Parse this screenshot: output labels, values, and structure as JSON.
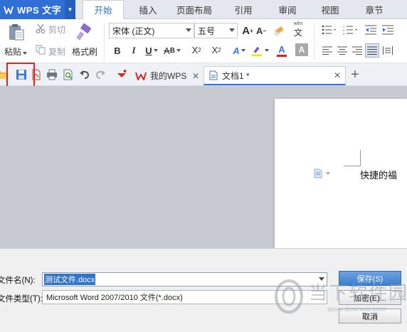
{
  "app": {
    "name": "WPS 文字"
  },
  "menu_tabs": [
    {
      "label": "开始",
      "active": true
    },
    {
      "label": "插入"
    },
    {
      "label": "页面布局"
    },
    {
      "label": "引用"
    },
    {
      "label": "审阅"
    },
    {
      "label": "视图"
    },
    {
      "label": "章节"
    }
  ],
  "ribbon": {
    "paste_label": "粘贴",
    "cut_label": "剪切",
    "copy_label": "复制",
    "format_painter_label": "格式刷",
    "font_name": "宋体 (正文)",
    "font_size": "五号",
    "phonetic_label": "wén",
    "phonetic_char": "文",
    "font_buttons": {
      "bold": "B",
      "italic": "I",
      "underline": "U",
      "grow": "A",
      "shrink": "A",
      "superscript": "X",
      "subscript": "X",
      "sup_mark": "2",
      "sub_mark": "2",
      "effect": "A",
      "font_color": "A",
      "char_shading": "A",
      "highlight_color": "#f5e400",
      "font_color_value": "#e02020"
    }
  },
  "quick_access": {
    "icons": [
      "open-icon",
      "save-icon",
      "export-pdf-icon",
      "print-icon",
      "print-preview-icon",
      "undo-icon",
      "redo-icon",
      "customize-icon"
    ]
  },
  "doc_tabs": [
    {
      "label": "我的WPS",
      "active": false
    },
    {
      "label": "文档1 *",
      "active": true
    }
  ],
  "document": {
    "visible_text": "快捷的福"
  },
  "save_dialog": {
    "filename_label": "文件名(N):",
    "filename_value": "测试文件.docx",
    "filetype_label": "文件类型(T):",
    "filetype_value": "Microsoft Word 2007/2010 文件(*.docx)",
    "save_button": "保存(S)",
    "encrypt_button": "加密(E)...",
    "cancel_button": "取消"
  },
  "watermark": {
    "title": "当下软件园",
    "url": "www.downxia.com"
  },
  "colors": {
    "brand": "#2f6fd6",
    "highlight_box": "#e8201e",
    "workspace": "#c7cad1"
  }
}
